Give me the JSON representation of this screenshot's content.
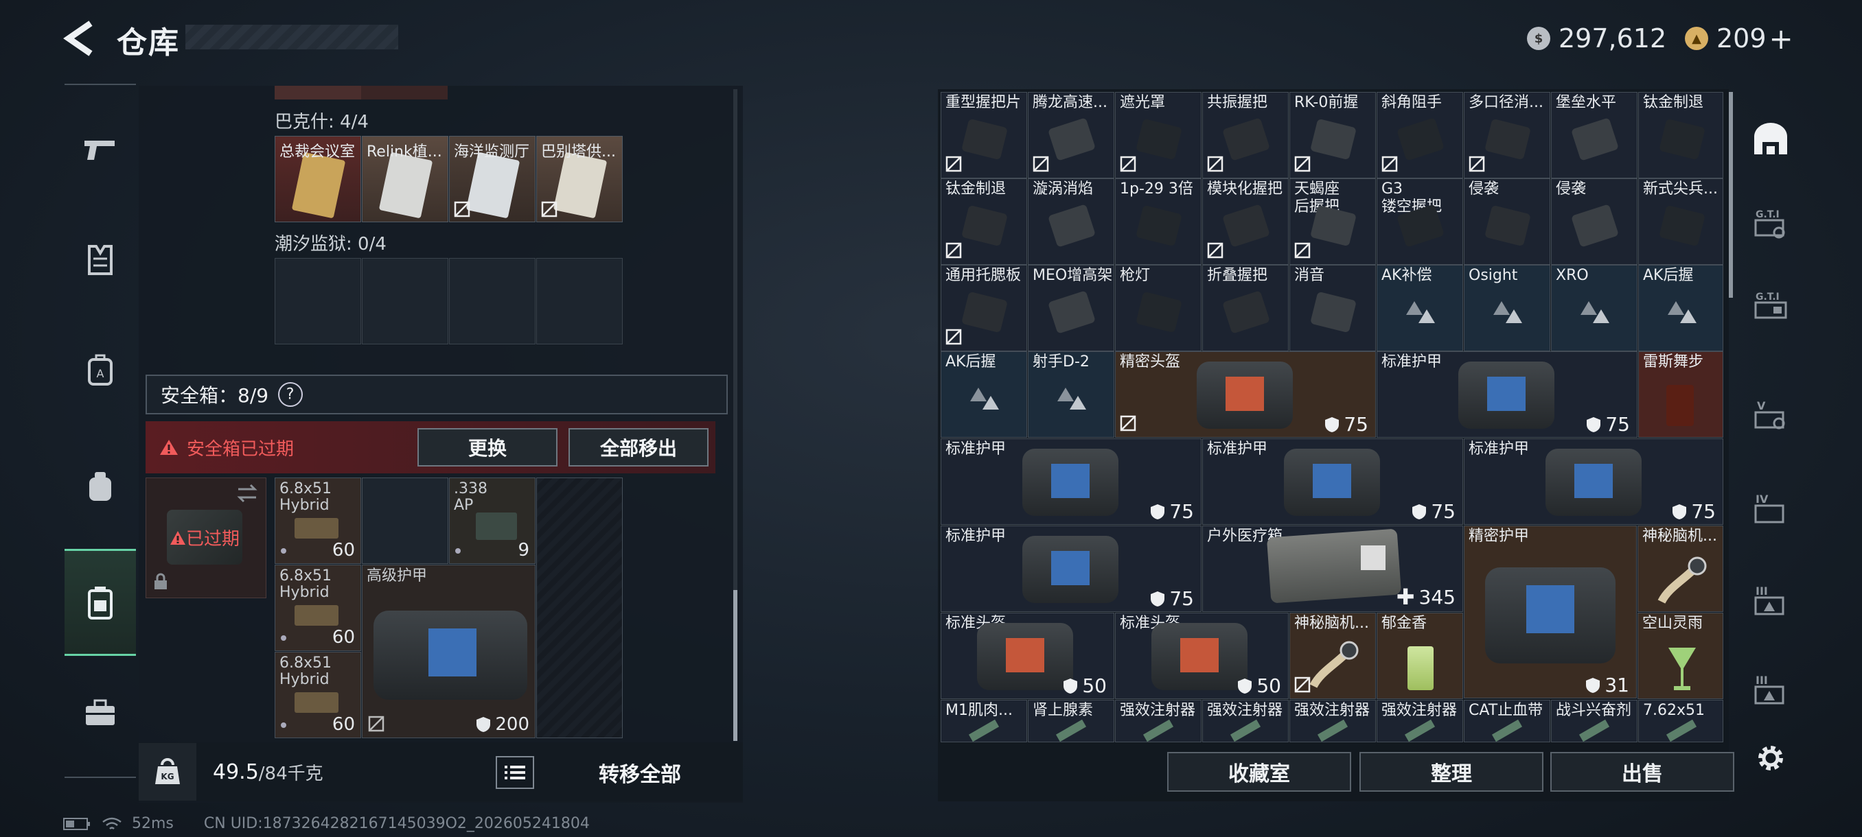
{
  "header": {
    "title": "仓库",
    "currency1": "297,612",
    "currency2": "209",
    "plus": "+"
  },
  "left": {
    "bakshi_label": "巴克什: 4/4",
    "cards": [
      {
        "label": "总裁会议室",
        "bg": "#8a3d35"
      },
      {
        "label": "Relink植...",
        "bg": "#c7c8c6"
      },
      {
        "label": "海洋监测厅",
        "bg": "#c5c9cc"
      },
      {
        "label": "巴别塔供...",
        "bg": "#c9c5bb"
      }
    ],
    "chaoxi_label": "潮汐监狱: 0/4",
    "safe_label": "安全箱：8/9",
    "help": "?",
    "expired_warning": "安全箱已过期",
    "replace_btn": "更换",
    "remove_all_btn": "全部移出",
    "expired_badge": "已过期",
    "slots": [
      {
        "l1": "6.8x51",
        "l2": "Hybrid",
        "count": "60"
      },
      {
        "l1": ".338",
        "l2": "AP",
        "count": "9"
      },
      {
        "l1": "6.8x51",
        "l2": "Hybrid",
        "count": "60"
      },
      {
        "l1": "6.8x51",
        "l2": "Hybrid",
        "count": "60"
      }
    ],
    "armor": {
      "label": "高级护甲",
      "value": "200"
    },
    "weight_value": "49.5",
    "weight_max": "/84千克",
    "transfer_all": "转移全部"
  },
  "right": {
    "row1": [
      "重型握把片",
      "腾龙高速...",
      "遮光罩",
      "共振握把",
      "RK-0前握",
      "斜角阻手",
      "多口径消...",
      "堡垒水平",
      "钛金制退"
    ],
    "row2": [
      "钛金制退",
      "漩涡消焰",
      "1p-29 3倍",
      "模块化握把",
      "天蝎座\n后握把",
      "G3\n镂空握把",
      "侵袭",
      "侵袭",
      "新式尖兵..."
    ],
    "row3": [
      "通用托腮板",
      "MEO增高架",
      "枪灯",
      "折叠握把",
      "消音",
      "AK补偿",
      "Osight",
      "XRO",
      "AK后握"
    ],
    "r4a": "AK后握",
    "r4b": "射手D-2",
    "precise_helmet": "精密头盔",
    "precise_helmet_val": "75",
    "std_armor": "标准护甲",
    "std_armor_val": "75",
    "leisi": "雷斯舞步",
    "outdoor_med": "户外医疗箱",
    "outdoor_med_val": "345",
    "precise_armor": "精密护甲",
    "precise_armor_val": "31",
    "brain": "神秘脑机...",
    "std_helmet": "标准头盔",
    "std_helmet_val": "50",
    "yujin": "郁金香",
    "kongshan": "空山灵雨",
    "row8": [
      "M1肌肉...",
      "肾上腺素",
      "强效注射器",
      "强效注射器",
      "强效注射器",
      "强效注射器",
      "CAT止血带",
      "战斗兴奋剂",
      "7.62x51"
    ]
  },
  "bottom": {
    "collection": "收藏室",
    "arrange": "整理",
    "sell": "出售"
  },
  "status": {
    "ping": "52ms",
    "uid": "CN UID:1873264282167145039O2_202605241804"
  }
}
